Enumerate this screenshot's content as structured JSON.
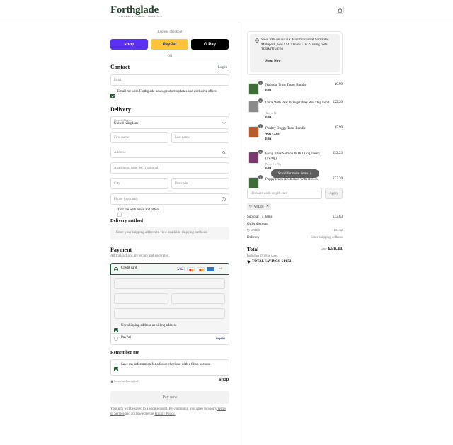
{
  "header": {
    "logo": "Forthglade",
    "logo_sub": "NATURAL PET FOOD · SINCE 1971",
    "bag_icon": "bag-icon"
  },
  "express": {
    "label": "Express checkout",
    "shop_label": "shop",
    "paypal_label": "PayPal",
    "gpay_label": "G Pay",
    "or_label": "OR",
    "colors": {
      "shop": "#5a31f4",
      "paypal": "#ffc439",
      "gpay": "#000000"
    }
  },
  "contact": {
    "title": "Contact",
    "login_label": "Log in",
    "email_placeholder": "Email",
    "news_label": "Email me with Forthglade news, product updates and exclusive offers"
  },
  "delivery": {
    "title": "Delivery",
    "country_label": "Country/Region",
    "country_value": "United Kingdom",
    "first_name": "First name",
    "last_name": "Last name",
    "address": "Address",
    "apartment": "Apartment, suite, etc. (optional)",
    "city": "City",
    "postcode": "Postcode",
    "phone": "Phone (optional)",
    "text_me": "Text me with news and offers"
  },
  "delivery_method": {
    "title": "Delivery method",
    "message": "Enter your shipping address to view available shipping methods."
  },
  "payment": {
    "title": "Payment",
    "subtitle": "All transactions are secure and encrypted.",
    "credit_card": "Credit card",
    "more_cards": "+4",
    "billing_label": "Use shipping address as billing address",
    "paypal_label": "PayPal"
  },
  "remember": {
    "title": "Remember me",
    "save_label": "Save my information for a faster checkout with a Shop account",
    "secure_label": "Secure and encrypted",
    "shop_label": "shop"
  },
  "pay_now": "Pay now",
  "footer": {
    "text": "Your info will be saved to a Shop account. By continuing, you agree to Shop's",
    "tos": "Terms of Service",
    "and": "and acknowledge the",
    "privacy": "Privacy Policy."
  },
  "promo": {
    "text": "Save 30% on our 6 x Multifunctional Soft Bites Multipack, was £14.70 now £10.29 using code TERMTIME30",
    "button": "Shop Now"
  },
  "items": [
    {
      "name": "National Trust Taster Bundle",
      "price": "£9.99",
      "qty": "1",
      "variant": "",
      "was": "",
      "edit": "Edit",
      "color": "#3f6d3a"
    },
    {
      "name": "Duck With Pear & Vegetables Wet Dog Food",
      "price": "£22.20",
      "qty": "1",
      "variant": "Tray x 12",
      "was": "",
      "edit": "Edit",
      "color": "#8a8a8a"
    },
    {
      "name": "Poultry Doggy Treat Bundle",
      "price": "£5.99",
      "qty": "1",
      "variant": "",
      "was": "Was £7.69",
      "edit": "Edit",
      "color": "#b85a2a"
    },
    {
      "name": "Fishy Bites Salmon & Dill Dog Treats (1x70g)",
      "price": "£12.23",
      "qty": "1",
      "variant": "Pack: 6 x 70g",
      "was": "",
      "edit": "Edit",
      "color": "#7b3a6e"
    },
    {
      "name": "Puppy Duck & Chicken With Brown",
      "price": "£22.20",
      "qty": "1",
      "variant": "",
      "was": "",
      "edit": "",
      "color": "#3f6d3a"
    }
  ],
  "scroll_hint": "Scroll for more items",
  "discount": {
    "placeholder": "Discount code or gift card",
    "apply": "Apply",
    "code": "WB201"
  },
  "summary": {
    "subtotal_label": "Subtotal · 5 items",
    "subtotal_value": "£72.63",
    "order_discount_label": "Order discount",
    "code_label": "WB201",
    "code_value": "- £14.52",
    "delivery_label": "Delivery",
    "delivery_value": "Enter shipping address",
    "total_label": "Total",
    "currency": "GBP",
    "total_value": "£58.11",
    "taxes": "Including £9.68 in taxes",
    "savings_label": "TOTAL SAVINGS",
    "savings_value": "£14.52"
  }
}
